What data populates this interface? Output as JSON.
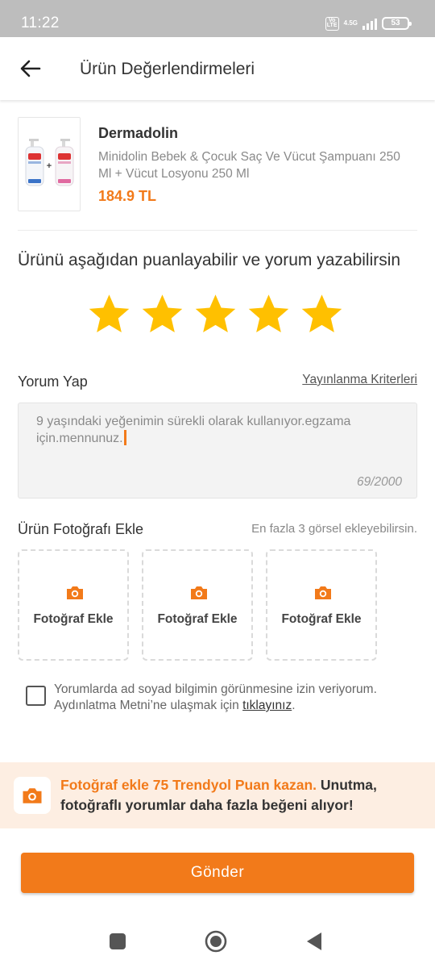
{
  "status_bar": {
    "time": "11:22",
    "network_badge": "Vo LTE",
    "network_type": "4.5G",
    "battery_level": "53",
    "signal_strength_bars": 4
  },
  "app_bar": {
    "back_icon": "back-arrow-icon",
    "title": "Ürün Değerlendirmeleri"
  },
  "product": {
    "brand": "Dermadolin",
    "name": "Minidolin Bebek & Çocuk Saç Ve Vücut Şampuanı 250 Ml + Vücut Losyonu 250 Ml",
    "price": "184.9 TL",
    "image_plus": "+"
  },
  "rating": {
    "heading": "Ürünü aşağıdan puanlayabilir ve yorum yazabilirsin",
    "value": 5,
    "max": 5,
    "star_color": "#FFC000"
  },
  "comment": {
    "label": "Yorum Yap",
    "criteria_link": "Yayınlanma Kriterleri",
    "text": "9 yaşındaki yeğenimin sürekli olarak kullanıyor.egzama için.mennunuz.",
    "counter": "69/2000"
  },
  "photos": {
    "label": "Ürün Fotoğrafı Ekle",
    "hint": "En fazla 3 görsel ekleyebilirsin.",
    "slots": [
      {
        "label": "Fotoğraf Ekle",
        "icon": "camera-icon"
      },
      {
        "label": "Fotoğraf Ekle",
        "icon": "camera-icon"
      },
      {
        "label": "Fotoğraf Ekle",
        "icon": "camera-icon"
      }
    ]
  },
  "consent": {
    "checked": false,
    "text": "Yorumlarda ad soyad bilgimin görünmesine izin veriyorum. Aydınlatma Metni’ne ulaşmak için",
    "link": "tıklayınız",
    "suffix": "."
  },
  "promo": {
    "icon": "camera-icon",
    "highlight": "Fotoğraf ekle 75 Trendyol Puan kazan.",
    "rest": "Unutma, fotoğraflı yorumlar daha fazla beğeni alıyor!"
  },
  "submit": {
    "label": "Gönder"
  },
  "nav_bar": {
    "recents_icon": "square-recents-icon",
    "home_icon": "circle-home-icon",
    "back_icon": "triangle-back-icon"
  },
  "colors": {
    "accent": "#F27A1A",
    "promo_background": "#FDEEE2",
    "status_bar": "#BDBDBD",
    "comment_box": "#F3F3F3"
  }
}
